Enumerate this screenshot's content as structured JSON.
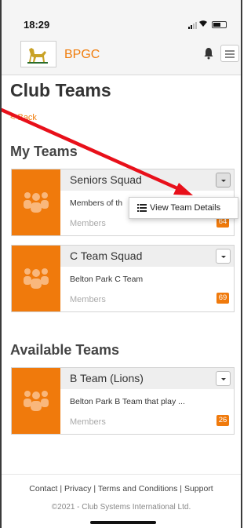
{
  "status_bar": {
    "time": "18:29"
  },
  "header": {
    "brand": "BPGC"
  },
  "page": {
    "title": "Club Teams",
    "back_label": "< Back"
  },
  "my_teams": {
    "heading": "My Teams",
    "cards": [
      {
        "name": "Seniors Squad",
        "description": "Members of th",
        "members_label": "Members",
        "count": "64"
      },
      {
        "name": "C Team Squad",
        "description": "Belton Park C Team",
        "members_label": "Members",
        "count": "69"
      }
    ]
  },
  "dropdown": {
    "label": "View Team Details"
  },
  "available_teams": {
    "heading": "Available Teams",
    "cards": [
      {
        "name": "B Team (Lions)",
        "description": "Belton Park B Team that play ...",
        "members_label": "Members",
        "count": "26"
      }
    ]
  },
  "footer": {
    "links": [
      "Contact",
      "Privacy",
      "Terms and Conditions",
      "Support"
    ],
    "separator": " | ",
    "copyright": "©2021 - Club Systems International Ltd."
  },
  "colors": {
    "accent": "#f07a0c",
    "annotation_arrow": "#e8101a"
  },
  "icons": [
    "bell-icon",
    "hamburger-icon",
    "team-group-icon",
    "list-icon",
    "caret-down-icon",
    "club-logo"
  ]
}
